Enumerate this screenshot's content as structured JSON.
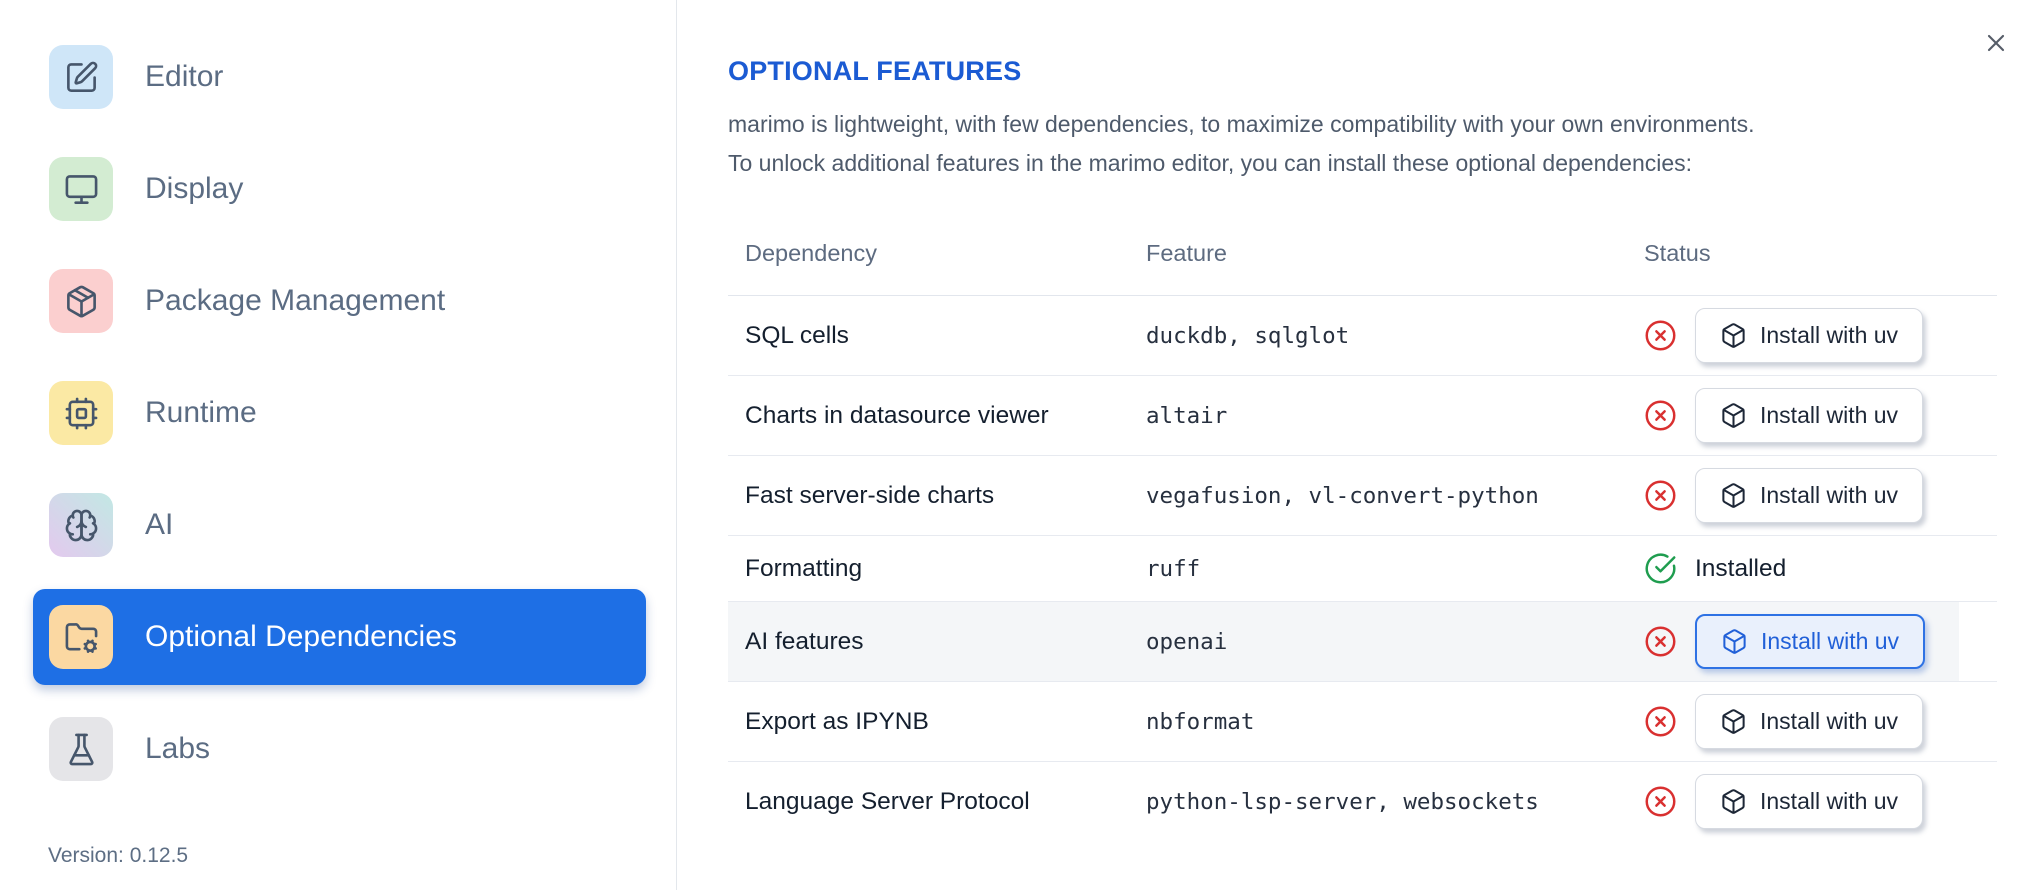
{
  "sidebar": {
    "items": [
      {
        "label": "Editor",
        "icon": "square-pen-icon",
        "symbol": "icon-square-pen",
        "icon_bg": "#cfe6f8"
      },
      {
        "label": "Display",
        "icon": "monitor-icon",
        "symbol": "icon-monitor",
        "icon_bg": "#d3ecd2"
      },
      {
        "label": "Package Management",
        "icon": "package-icon",
        "symbol": "icon-package",
        "icon_bg": "#fbcfcf"
      },
      {
        "label": "Runtime",
        "icon": "cpu-icon",
        "symbol": "icon-cpu",
        "icon_bg": "#fbe9a4"
      },
      {
        "label": "AI",
        "icon": "brain-icon",
        "symbol": "icon-brain",
        "icon_bg": "linear-gradient(45deg, #e3c9ee 0%, #c2e8e4 100%)"
      },
      {
        "label": "Optional Dependencies",
        "icon": "folder-cog-icon",
        "symbol": "icon-folder-cog",
        "icon_bg": "#fbd8a2",
        "selected": true
      },
      {
        "label": "Labs",
        "icon": "flask-icon",
        "symbol": "icon-flask",
        "icon_bg": "#e5e5e8"
      }
    ],
    "version_label": "Version: 0.12.5"
  },
  "panel": {
    "title": "OPTIONAL FEATURES",
    "description_line1": "marimo is lightweight, with few dependencies, to maximize compatibility with your own environments.",
    "description_line2": "To unlock additional features in the marimo editor, you can install these optional dependencies:",
    "close_icon": "close-icon",
    "table": {
      "columns": [
        "Dependency",
        "Feature",
        "Status"
      ],
      "install_action_label": "Install with uv",
      "installed_label": "Installed",
      "rows": [
        {
          "dependency": "SQL cells",
          "feature": "duckdb, sqlglot",
          "status": "missing",
          "action": "Install with uv"
        },
        {
          "dependency": "Charts in datasource viewer",
          "feature": "altair",
          "status": "missing",
          "action": "Install with uv"
        },
        {
          "dependency": "Fast server-side charts",
          "feature": "vegafusion, vl-convert-python",
          "status": "missing",
          "action": "Install with uv"
        },
        {
          "dependency": "Formatting",
          "feature": "ruff",
          "status": "installed",
          "status_label": "Installed"
        },
        {
          "dependency": "AI features",
          "feature": "openai",
          "status": "missing",
          "action": "Install with uv",
          "highlighted": true
        },
        {
          "dependency": "Export as IPYNB",
          "feature": "nbformat",
          "status": "missing",
          "action": "Install with uv"
        },
        {
          "dependency": "Language Server Protocol",
          "feature": "python-lsp-server, websockets",
          "status": "missing",
          "action": "Install with uv"
        }
      ]
    }
  },
  "colors": {
    "selected_item_blue": "#1e6fe5",
    "title_blue": "#1b5bd3",
    "status_red": "#d93030",
    "status_green": "#1f9d4f",
    "active_button_blue": "#2160d8",
    "row_highlight": "#f4f6f8"
  }
}
